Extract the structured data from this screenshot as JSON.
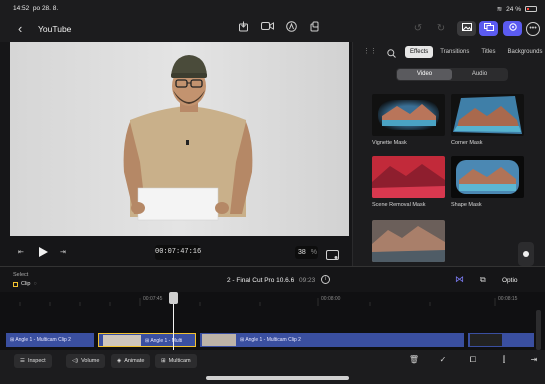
{
  "status_bar": {
    "time": "14:52",
    "date": "po 28. 8.",
    "battery": "24 %"
  },
  "toolbar": {
    "back_glyph": "‹",
    "project_title": "YouTube"
  },
  "viewer": {
    "timecode": "00:07:47:16",
    "zoom_value": "38",
    "zoom_unit": "%"
  },
  "browser": {
    "tabs": [
      "Effects",
      "Transitions",
      "Titles",
      "Backgrounds"
    ],
    "active_tab": "Effects",
    "segments": [
      "Video",
      "Audio"
    ],
    "effects": [
      {
        "name": "Vignette Mask"
      },
      {
        "name": "Corner Mask"
      },
      {
        "name": "Scene Removal Mask"
      },
      {
        "name": "Shape Mask"
      },
      {
        "name": ""
      }
    ]
  },
  "timeline": {
    "select_label": "Select",
    "clip_label": "Clip",
    "project_name": "2 - Final Cut Pro 10.6.6",
    "duration": "09:23",
    "options_label": "Optio",
    "ruler": [
      "00:07:45",
      "00:08:00",
      "00:08:15"
    ],
    "clips": [
      "Angle 1 - Multicam Clip 2",
      "Angle 1 - Multi",
      "Angle 1 - Multicam Clip 2"
    ]
  },
  "bottom_bar": {
    "inspect": "Inspect",
    "volume": "Volume",
    "animate": "Animate",
    "multicam": "Multicam"
  },
  "colors": {
    "accent": "#5b5bf0",
    "clip_blue": "#3a4fa0",
    "clip_yellow": "#f2c230"
  }
}
